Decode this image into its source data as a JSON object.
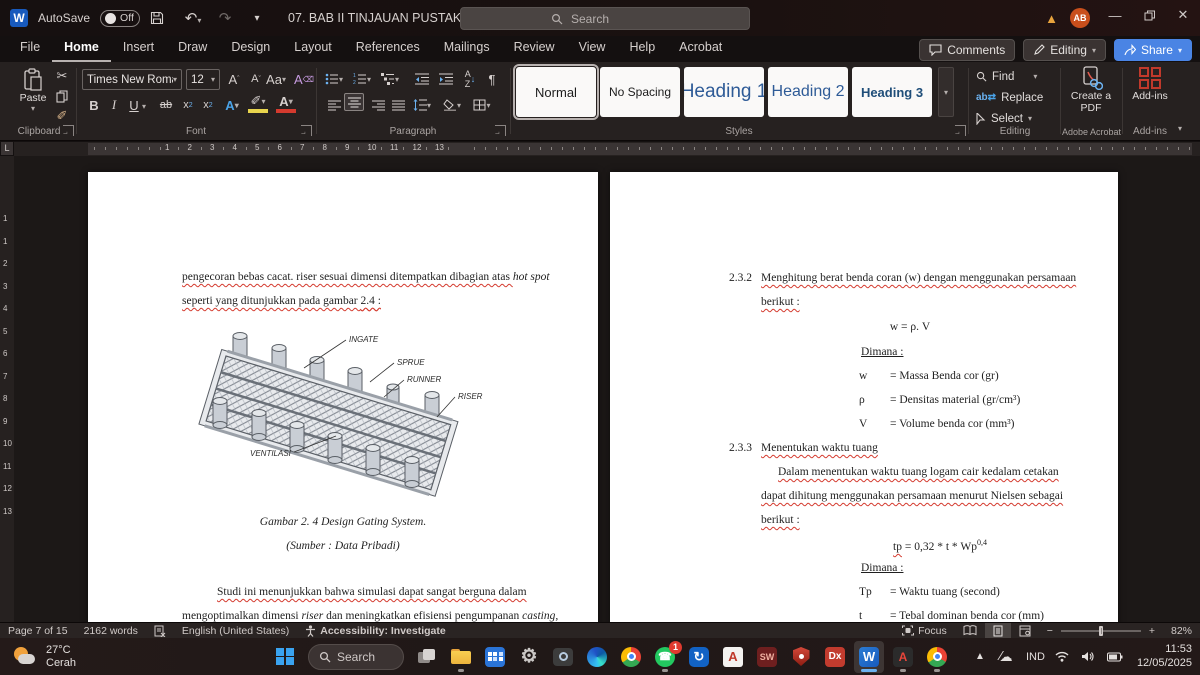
{
  "titlebar": {
    "autosave_label": "AutoSave",
    "autosave_state": "Off",
    "doc_title": "07. BAB II TINJAUAN PUSTAKA",
    "search_placeholder": "Search",
    "avatar_initials": "AB",
    "comments_label": "Comments",
    "editing_label": "Editing",
    "share_label": "Share"
  },
  "ribbon": {
    "tabs": [
      "File",
      "Home",
      "Insert",
      "Draw",
      "Design",
      "Layout",
      "References",
      "Mailings",
      "Review",
      "View",
      "Help",
      "Acrobat"
    ],
    "active_index": 1,
    "clipboard": {
      "paste": "Paste",
      "label": "Clipboard"
    },
    "font": {
      "name": "Times New Roman",
      "size": "12",
      "label": "Font"
    },
    "paragraph": {
      "label": "Paragraph"
    },
    "styles": {
      "items": [
        "Normal",
        "No Spacing",
        "Heading 1",
        "Heading 2",
        "Heading 3"
      ],
      "selected": "Normal",
      "label": "Styles"
    },
    "editing": {
      "find": "Find",
      "replace": "Replace",
      "select": "Select",
      "label": "Editing"
    },
    "acrobat": {
      "button": "Create a PDF",
      "label": "Adobe Acrobat"
    },
    "addins": {
      "button": "Add-ins",
      "label": "Add-ins"
    }
  },
  "ruler": {
    "h_numbers": [
      "1",
      "2",
      "3",
      "4",
      "5",
      "6",
      "7",
      "8",
      "9",
      "10",
      "11",
      "12",
      "13"
    ],
    "v_numbers": [
      "1",
      "1",
      "2",
      "3",
      "4",
      "5",
      "6",
      "7",
      "8",
      "9",
      "10",
      "11",
      "12",
      "13"
    ]
  },
  "document": {
    "left": {
      "para1a": [
        {
          "t": "pengecoran bebas cacat. riser sesuai dimensi ditempatkan dibagian atas ",
          "sp": true
        },
        {
          "t": "hot spot",
          "i": true
        }
      ],
      "para1b": [
        {
          "t": "seperti yang ditunjukkan pada gambar ",
          "sp": true
        },
        {
          "t": "2.4 :",
          "u": true,
          "sp": true
        }
      ],
      "figure_labels": {
        "ingate": "INGATE",
        "sprue": "SPRUE",
        "runner": "RUNNER",
        "riser": "RISER",
        "ventilasi": "VENTILASI"
      },
      "caption1": "Gambar 2. 4 Design Gating System.",
      "caption2": "(Sumber : Data Pribadi)",
      "para2a": [
        {
          "t": "Studi ini menunjukkan bahwa simulasi dapat sangat berguna dalam",
          "sp": true
        }
      ],
      "para2b": [
        {
          "t": "mengoptimalkan dimensi ",
          "sp": true
        },
        {
          "t": "riser",
          "i": true,
          "sp": true
        },
        {
          "t": " dan meningkatkan efisiensi pengumpanan ",
          "sp": true
        },
        {
          "t": "casting,",
          "i": true,
          "sp": true
        }
      ]
    },
    "right": {
      "s232_num": "2.3.2",
      "s232_l1": [
        {
          "t": "Menghitung berat benda coran (w) dengan menggunakan persamaan",
          "sp": true
        }
      ],
      "s232_l2": [
        {
          "t": "berikut :",
          "sp": true
        }
      ],
      "formula1": "w = ρ. V",
      "dimana1": "Dimana :",
      "defs1": [
        [
          "w",
          "= Massa Benda cor (gr)"
        ],
        [
          "ρ",
          "= Densitas material (gr/cm³)"
        ],
        [
          "V",
          "= Volume benda cor (mm³)"
        ]
      ],
      "s233_num": "2.3.3",
      "s233_title": [
        {
          "t": "Menentukan waktu tuang",
          "sp": true
        }
      ],
      "s233_p1": [
        {
          "t": "Dalam menentukan waktu tuang logam cair kedalam cetakan",
          "sp": true
        }
      ],
      "s233_p2": [
        {
          "t": "dapat dihitung menggunakan persamaan menurut Nielsen sebagai",
          "sp": true
        }
      ],
      "s233_p3": [
        {
          "t": "berikut :",
          "sp": true
        }
      ],
      "formula2": [
        {
          "t": "tp",
          "sp": true
        },
        {
          "t": " = 0,32 * t * Wp"
        },
        {
          "t": "0,4",
          "sup": true
        }
      ],
      "dimana2": "Dimana :",
      "defs2": [
        [
          "Tp",
          "= Waktu tuang (second)"
        ],
        [
          "t",
          "= Tebal dominan benda cor (mm)"
        ]
      ]
    }
  },
  "statusbar": {
    "page": "Page 7 of 15",
    "words": "2162 words",
    "language": "English (United States)",
    "accessibility": "Accessibility: Investigate",
    "focus": "Focus",
    "zoom": "82%"
  },
  "taskbar": {
    "weather_temp": "27°C",
    "weather_desc": "Cerah",
    "search_label": "Search",
    "apps": [
      {
        "name": "task-view"
      },
      {
        "name": "file-explorer",
        "open": true
      },
      {
        "name": "calculator"
      },
      {
        "name": "settings"
      },
      {
        "name": "camera"
      },
      {
        "name": "edge"
      },
      {
        "name": "chrome"
      },
      {
        "name": "whatsapp",
        "badge": "1",
        "open": true
      },
      {
        "name": "sync-app"
      },
      {
        "name": "autocad"
      },
      {
        "name": "solidworks"
      },
      {
        "name": "security-shield"
      },
      {
        "name": "dx-app"
      },
      {
        "name": "word",
        "open": true,
        "active": true
      },
      {
        "name": "acrobat",
        "open": true
      },
      {
        "name": "chrome-2",
        "open": true
      }
    ],
    "language": "IND",
    "time": "11:53",
    "date": "12/05/2025"
  },
  "colors": {
    "accent_blue": "#4a84e4",
    "word_blue": "#185abd",
    "avatar_orange": "#c94f1c",
    "warning_yellow": "#e8a33d",
    "squiggle_red": "#d43a2e",
    "heading_blue": "#2e5b97"
  }
}
